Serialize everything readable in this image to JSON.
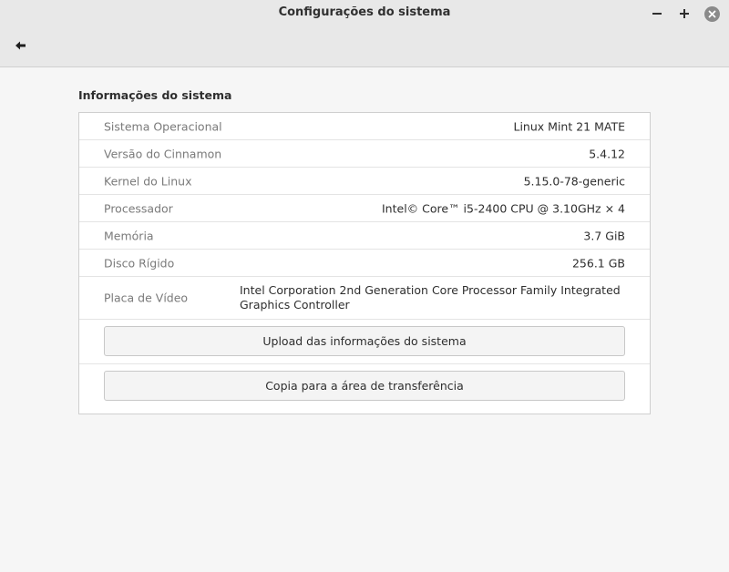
{
  "window": {
    "title": "Configurações do sistema",
    "controls": {
      "minimize_icon": "minimize-icon",
      "maximize_icon": "maximize-icon",
      "close_icon": "close-icon"
    },
    "back_icon": "back-arrow-icon"
  },
  "section": {
    "title": "Informações do sistema"
  },
  "info_rows": [
    {
      "label": "Sistema Operacional",
      "value": "Linux Mint 21 MATE"
    },
    {
      "label": "Versão do Cinnamon",
      "value": "5.4.12"
    },
    {
      "label": "Kernel do Linux",
      "value": "5.15.0-78-generic"
    },
    {
      "label": "Processador",
      "value": "Intel© Core™ i5-2400 CPU @ 3.10GHz × 4"
    },
    {
      "label": "Memória",
      "value": "3.7 GiB"
    },
    {
      "label": "Disco Rígido",
      "value": "256.1 GB"
    },
    {
      "label": "Placa de Vídeo",
      "value": "Intel Corporation 2nd Generation Core Processor Family Integrated Graphics Controller"
    }
  ],
  "buttons": {
    "upload_label": "Upload das informações do sistema",
    "copy_label": "Copia para a área de transferência"
  },
  "colors": {
    "header_bg": "#e8e8e8",
    "page_bg": "#f6f6f6",
    "panel_bg": "#ffffff",
    "label_text": "#7a7a7a",
    "value_text": "#2e2e2e",
    "close_button": "#8a8a8a"
  }
}
